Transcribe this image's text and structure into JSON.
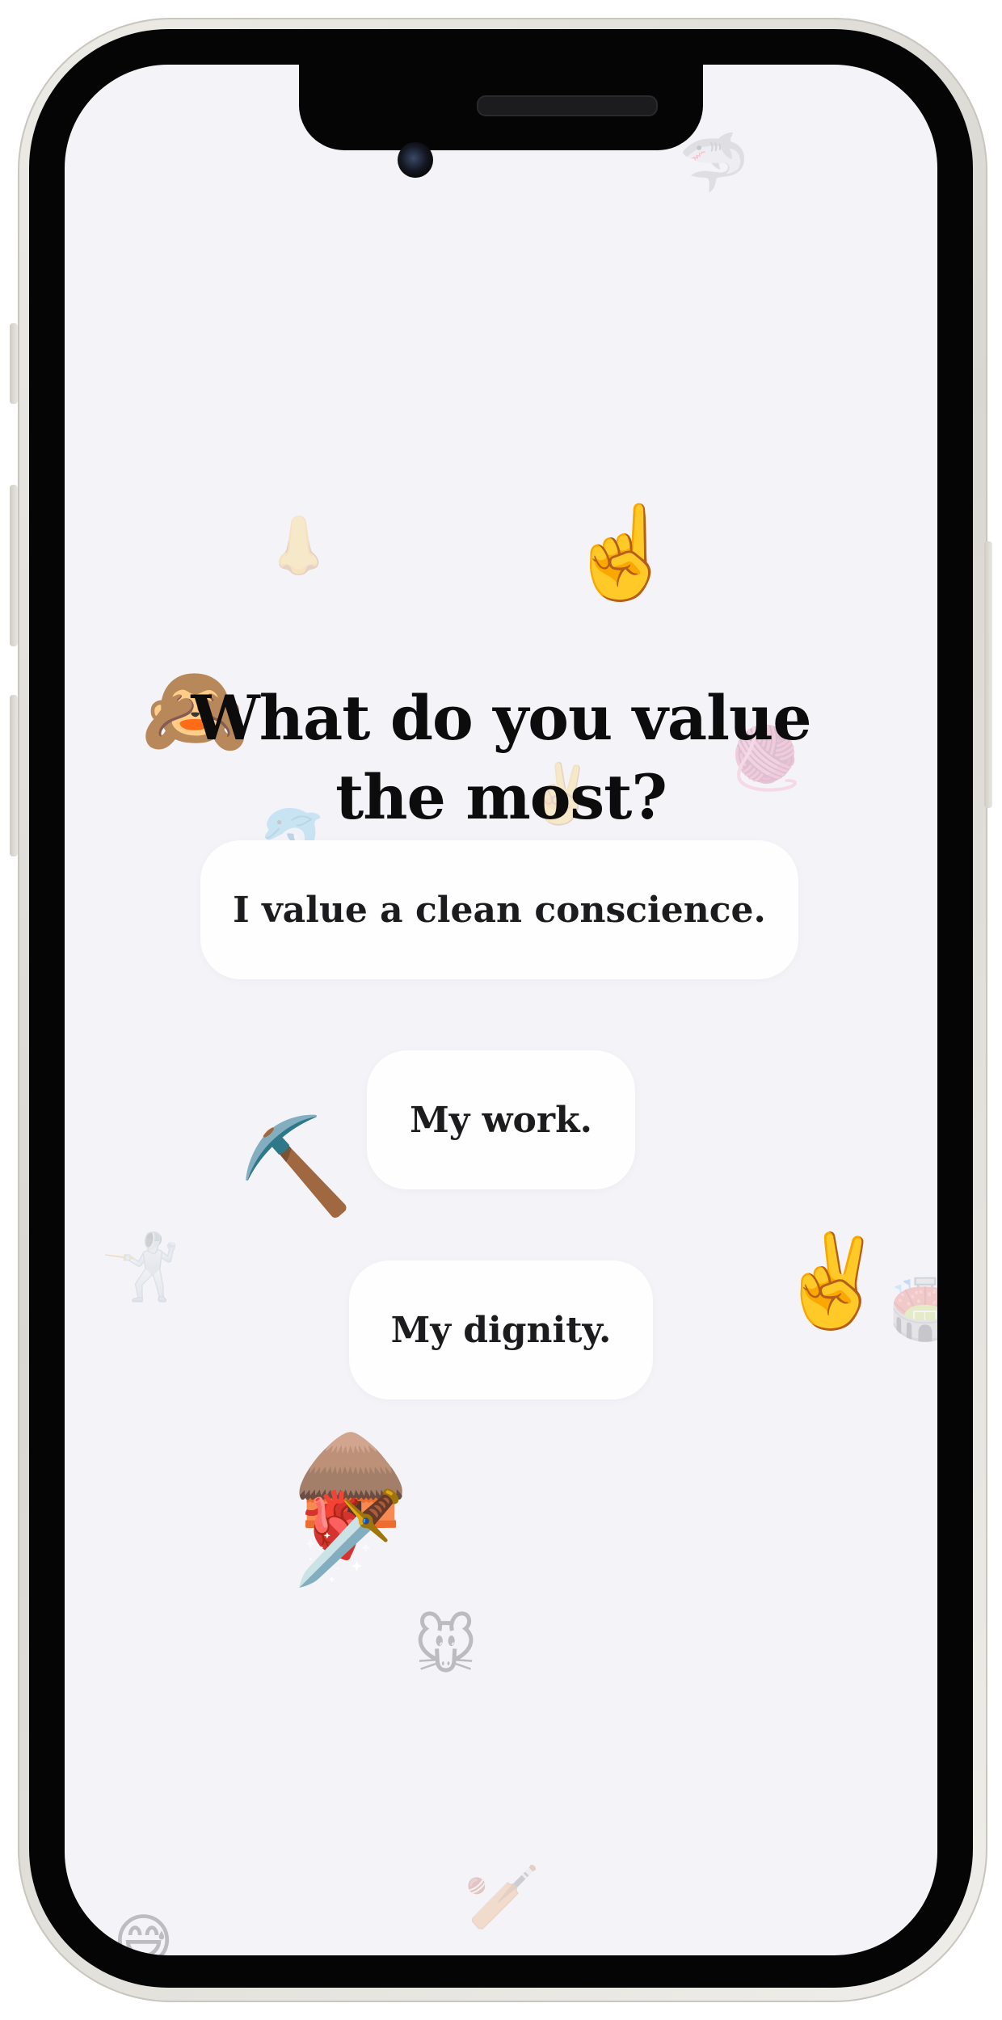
{
  "question": {
    "title_line1": "What do you value",
    "title_line2": "the most?"
  },
  "answers": [
    {
      "label": "I value a clean conscience."
    },
    {
      "label": "My work."
    },
    {
      "label": "My dignity."
    }
  ],
  "background_emojis": {
    "shark": "🦈",
    "nose": "👃",
    "index_up": "☝️",
    "see_no_evil_monkey": "🙈",
    "victory_faded": "✌️",
    "yarn": "🧶",
    "dolphin": "🐬",
    "pick": "⛏️",
    "person_fencing": "🤺",
    "victory": "✌️",
    "stadium": "🏟️",
    "hut": "🛖",
    "anatomical_heart": "🫀",
    "dagger": "🗡️",
    "mouse_face": "🐭",
    "cricket": "🏏",
    "sweat_smile": "😅"
  },
  "colors": {
    "screen_background": "#f3f3f8",
    "answer_background": "#fefefe",
    "title_text": "#0c0c0c",
    "answer_text": "#1c1c1e",
    "phone_frame": "#e4e2dc",
    "bezel": "#050505"
  }
}
